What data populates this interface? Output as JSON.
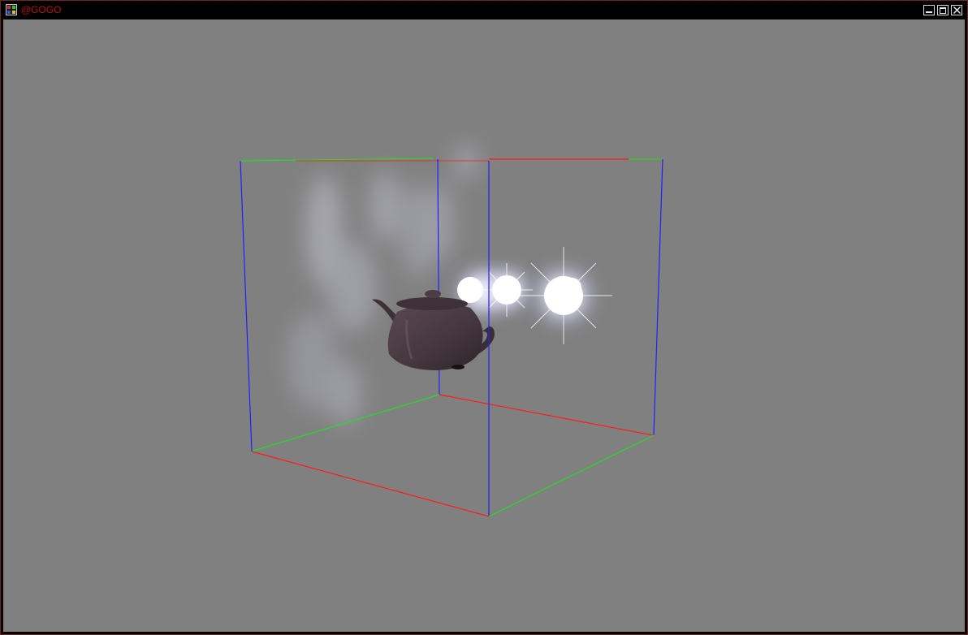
{
  "window": {
    "title": "@GOGO",
    "title_color": "#b01818",
    "background_color": "#808080",
    "icons": {
      "app": "grid-app-icon",
      "minimize": "minimize-icon",
      "maximize": "maximize-icon",
      "close": "close-icon"
    }
  },
  "scene": {
    "objects": [
      "teapot",
      "wireframe-box",
      "light-flares",
      "smoke-volume"
    ],
    "axis_colors": {
      "x": "#ff1a1a",
      "y": "#20e020",
      "z": "#2020ff"
    },
    "teapot_color": "#4a3a40"
  }
}
